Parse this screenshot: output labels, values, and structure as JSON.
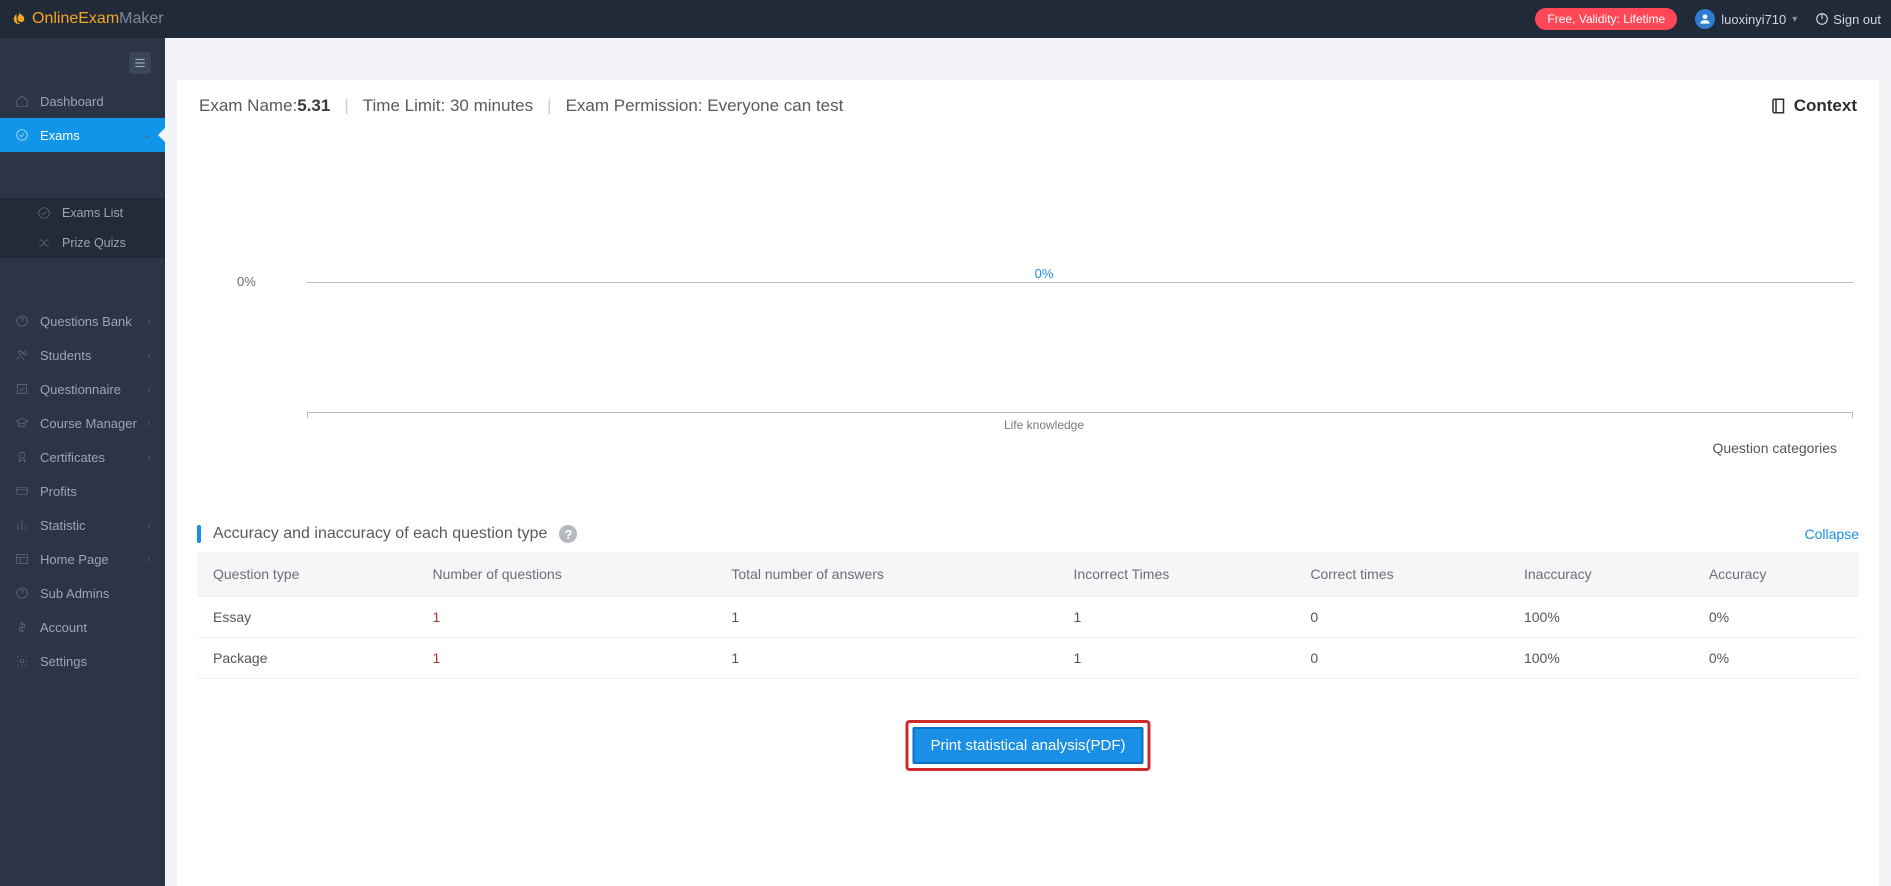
{
  "brand": {
    "part1": "OnlineExam",
    "part2": "Maker"
  },
  "topbar": {
    "pill": "Free, Validity: Lifetime",
    "username": "luoxinyi710",
    "signout": "Sign out"
  },
  "sidebar": {
    "items": [
      {
        "label": "Dashboard"
      },
      {
        "label": "Exams"
      },
      {
        "label": "Questions Bank"
      },
      {
        "label": "Students"
      },
      {
        "label": "Questionnaire"
      },
      {
        "label": "Course Manager"
      },
      {
        "label": "Certificates"
      },
      {
        "label": "Profits"
      },
      {
        "label": "Statistic"
      },
      {
        "label": "Home Page"
      },
      {
        "label": "Sub Admins"
      },
      {
        "label": "Account"
      },
      {
        "label": "Settings"
      }
    ],
    "sub": [
      {
        "label": "Exams List"
      },
      {
        "label": "Prize Quizs"
      }
    ]
  },
  "header": {
    "examNameLabel": "Exam Name: ",
    "examName": "5.31",
    "timeLimit": "Time Limit: 30 minutes",
    "permission": "Exam Permission: Everyone can test",
    "context": "Context"
  },
  "chart_data": {
    "type": "bar",
    "categories": [
      "Life knowledge"
    ],
    "values": [
      0
    ],
    "value_labels": [
      "0%"
    ],
    "y_tick_label": "0%",
    "x_title": "Question categories",
    "ylim": [
      0,
      100
    ]
  },
  "section": {
    "title": "Accuracy and inaccuracy of each question type",
    "collapse": "Collapse"
  },
  "table": {
    "headers": [
      "Question type",
      "Number of questions",
      "Total number of answers",
      "Incorrect Times",
      "Correct times",
      "Inaccuracy",
      "Accuracy"
    ],
    "rows": [
      {
        "type": "Essay",
        "nq": "1",
        "tna": "1",
        "inc": "1",
        "cor": "0",
        "inacc": "100%",
        "acc": "0%"
      },
      {
        "type": "Package",
        "nq": "1",
        "tna": "1",
        "inc": "1",
        "cor": "0",
        "inacc": "100%",
        "acc": "0%"
      }
    ]
  },
  "print": {
    "label": "Print statistical analysis(PDF)"
  }
}
